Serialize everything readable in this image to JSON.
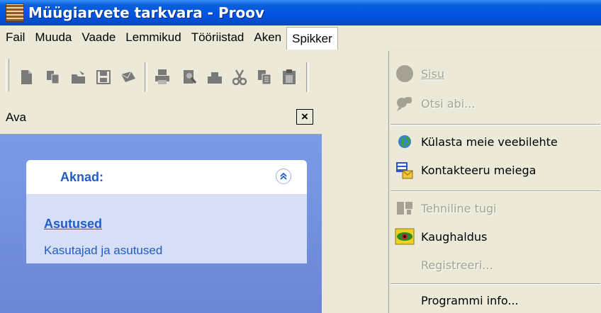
{
  "window": {
    "title": "Müügiarvete tarkvara - Proov"
  },
  "menubar": {
    "items": [
      {
        "label": "Fail"
      },
      {
        "label": "Muuda"
      },
      {
        "label": "Vaade"
      },
      {
        "label": "Lemmikud"
      },
      {
        "label": "Tööriistad"
      },
      {
        "label": "Aken"
      },
      {
        "label": "Spikker",
        "active": true
      }
    ]
  },
  "toolbar": {
    "buttons": [
      "new-document-icon",
      "copy-document-icon",
      "open-icon",
      "save-icon",
      "email-icon",
      "print-icon",
      "print-preview-icon",
      "printer-icon",
      "cut-icon",
      "copy-icon",
      "paste-icon"
    ]
  },
  "taskpane": {
    "title": "Ava",
    "close_glyph": "×",
    "group": {
      "title": "Aknad:",
      "link": "Asutused ",
      "description": "Kasutajad ja asutused"
    }
  },
  "help_menu": {
    "items": [
      {
        "label": "Sisu",
        "icon": "help-contents-icon",
        "enabled": false
      },
      {
        "label": "Otsi abi...",
        "icon": "search-help-icon",
        "enabled": false
      },
      {
        "label": "Külasta meie veebilehte",
        "icon": "globe-icon",
        "enabled": true
      },
      {
        "label": "Kontakteeru meiega",
        "icon": "contact-icon",
        "enabled": true
      },
      {
        "label": "Tehniline tugi",
        "icon": "support-icon",
        "enabled": false
      },
      {
        "label": "Kaughaldus",
        "icon": "remote-eye-icon",
        "enabled": true
      },
      {
        "label": "Registreeri...",
        "icon": "",
        "enabled": false
      },
      {
        "label": "Programmi info...",
        "icon": "",
        "enabled": true
      }
    ]
  },
  "colors": {
    "titlebar": "#0054e3",
    "menu_bg": "#ece9d8",
    "taskpane_bg": "#6b86d6",
    "link": "#215dc6",
    "disabled_text": "#a5a293"
  }
}
